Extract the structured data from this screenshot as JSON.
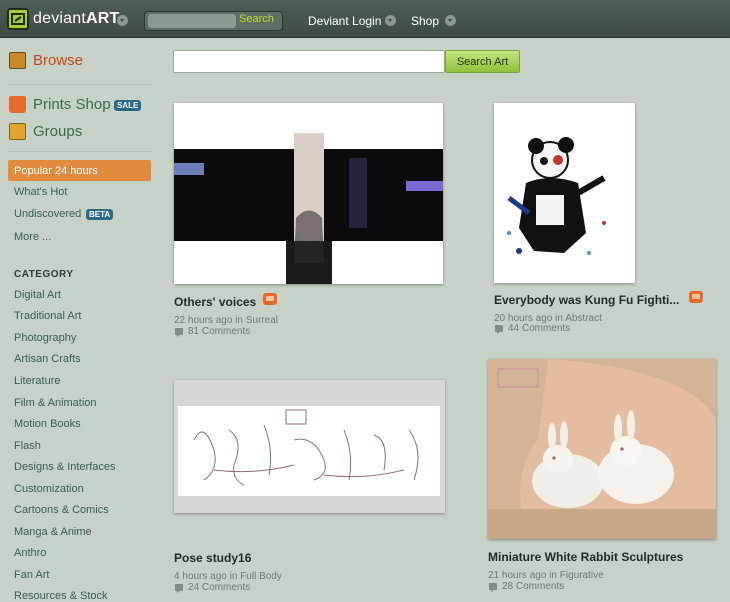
{
  "header": {
    "brand_light": "deviant",
    "brand_bold": "ART",
    "search_button": "Search",
    "login_label": "Deviant Login",
    "shop_label": "Shop",
    "colors": {
      "bar": "#3d4b42",
      "accent": "#b7dd33"
    }
  },
  "sidebar": {
    "browse_label": "Browse",
    "prints_label": "Prints Shop",
    "sale_badge": "SALE",
    "groups_label": "Groups",
    "popular_label": "Popular 24 hours",
    "whats_hot_label": "What's Hot",
    "undiscovered_label": "Undiscovered",
    "beta_badge": "BETA",
    "more_label": "More ...",
    "category_heading": "CATEGORY",
    "categories": [
      "Digital Art",
      "Traditional Art",
      "Photography",
      "Artisan Crafts",
      "Literature",
      "Film & Animation",
      "Motion Books",
      "Flash",
      "Designs & Interfaces",
      "Customization",
      "Cartoons & Comics",
      "Manga & Anime",
      "Anthro",
      "Fan Art",
      "Resources & Stock"
    ],
    "colors": {
      "popular_bg": "#e08b3e",
      "browse": "#c6461b",
      "link": "#3c5e4b"
    }
  },
  "search_art": {
    "button_label": "Search Art",
    "placeholder": ""
  },
  "deviations": [
    {
      "title": "Others' voices",
      "time": "22 hours ago",
      "in_word": "in",
      "category": "Surreal",
      "comments": "81 Comments"
    },
    {
      "title": "Everybody was Kung Fu Fighti...",
      "time": "20 hours ago",
      "in_word": "in",
      "category": "Abstract",
      "comments": "44 Comments"
    },
    {
      "title": "Pose study16",
      "time": "4 hours ago",
      "in_word": "in",
      "category": "Full Body",
      "comments": "24 Comments"
    },
    {
      "title": "Miniature White Rabbit Sculptures",
      "time": "21 hours ago",
      "in_word": "in",
      "category": "Figurative",
      "comments": "28 Comments"
    }
  ]
}
